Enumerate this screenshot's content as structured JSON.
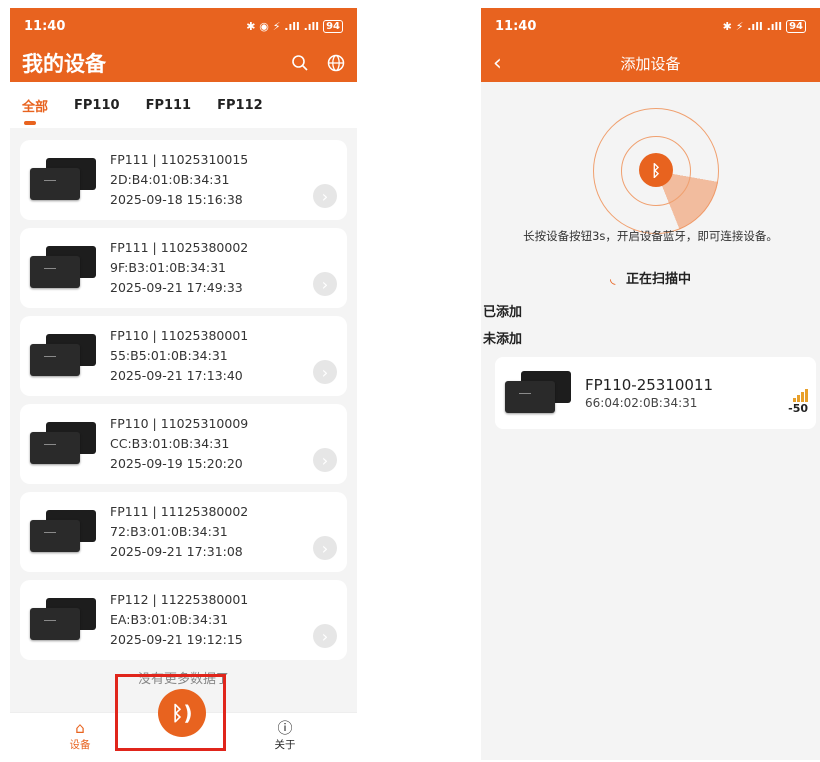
{
  "left": {
    "status": {
      "time": "11:40",
      "icons": "✱ ◉ ⚡ .ıll .ıll",
      "battery": "94"
    },
    "title": "我的设备",
    "tabs": [
      "全部",
      "FP110",
      "FP111",
      "FP112"
    ],
    "devices": [
      {
        "line1": "FP111 | 11025310015",
        "mac": "2D:B4:01:0B:34:31",
        "time": "2025-09-18 15:16:38"
      },
      {
        "line1": "FP111 | 11025380002",
        "mac": "9F:B3:01:0B:34:31",
        "time": "2025-09-21 17:49:33"
      },
      {
        "line1": "FP110 | 11025380001",
        "mac": "55:B5:01:0B:34:31",
        "time": "2025-09-21 17:13:40"
      },
      {
        "line1": "FP110 | 11025310009",
        "mac": "CC:B3:01:0B:34:31",
        "time": "2025-09-19 15:20:20"
      },
      {
        "line1": "FP111 | 11125380002",
        "mac": "72:B3:01:0B:34:31",
        "time": "2025-09-21 17:31:08"
      },
      {
        "line1": "FP112 | 11225380001",
        "mac": "EA:B3:01:0B:34:31",
        "time": "2025-09-21 19:12:15"
      }
    ],
    "no_more": "没有更多数据了",
    "nav": {
      "devices": "设备",
      "about": "关于"
    }
  },
  "right": {
    "status": {
      "time": "11:40",
      "icons": "✱ ⚡ .ıll .ıll",
      "battery": "94"
    },
    "title": "添加设备",
    "hint": "长按设备按钮3s，开启设备蓝牙，即可连接设备。",
    "scanning": "正在扫描中",
    "added_label": "已添加",
    "not_added_label": "未添加",
    "found": {
      "name": "FP110-25310011",
      "mac": "66:04:02:0B:34:31",
      "rssi": "-50"
    }
  },
  "colors": {
    "accent": "#e8631f",
    "highlight": "#e0251b"
  }
}
